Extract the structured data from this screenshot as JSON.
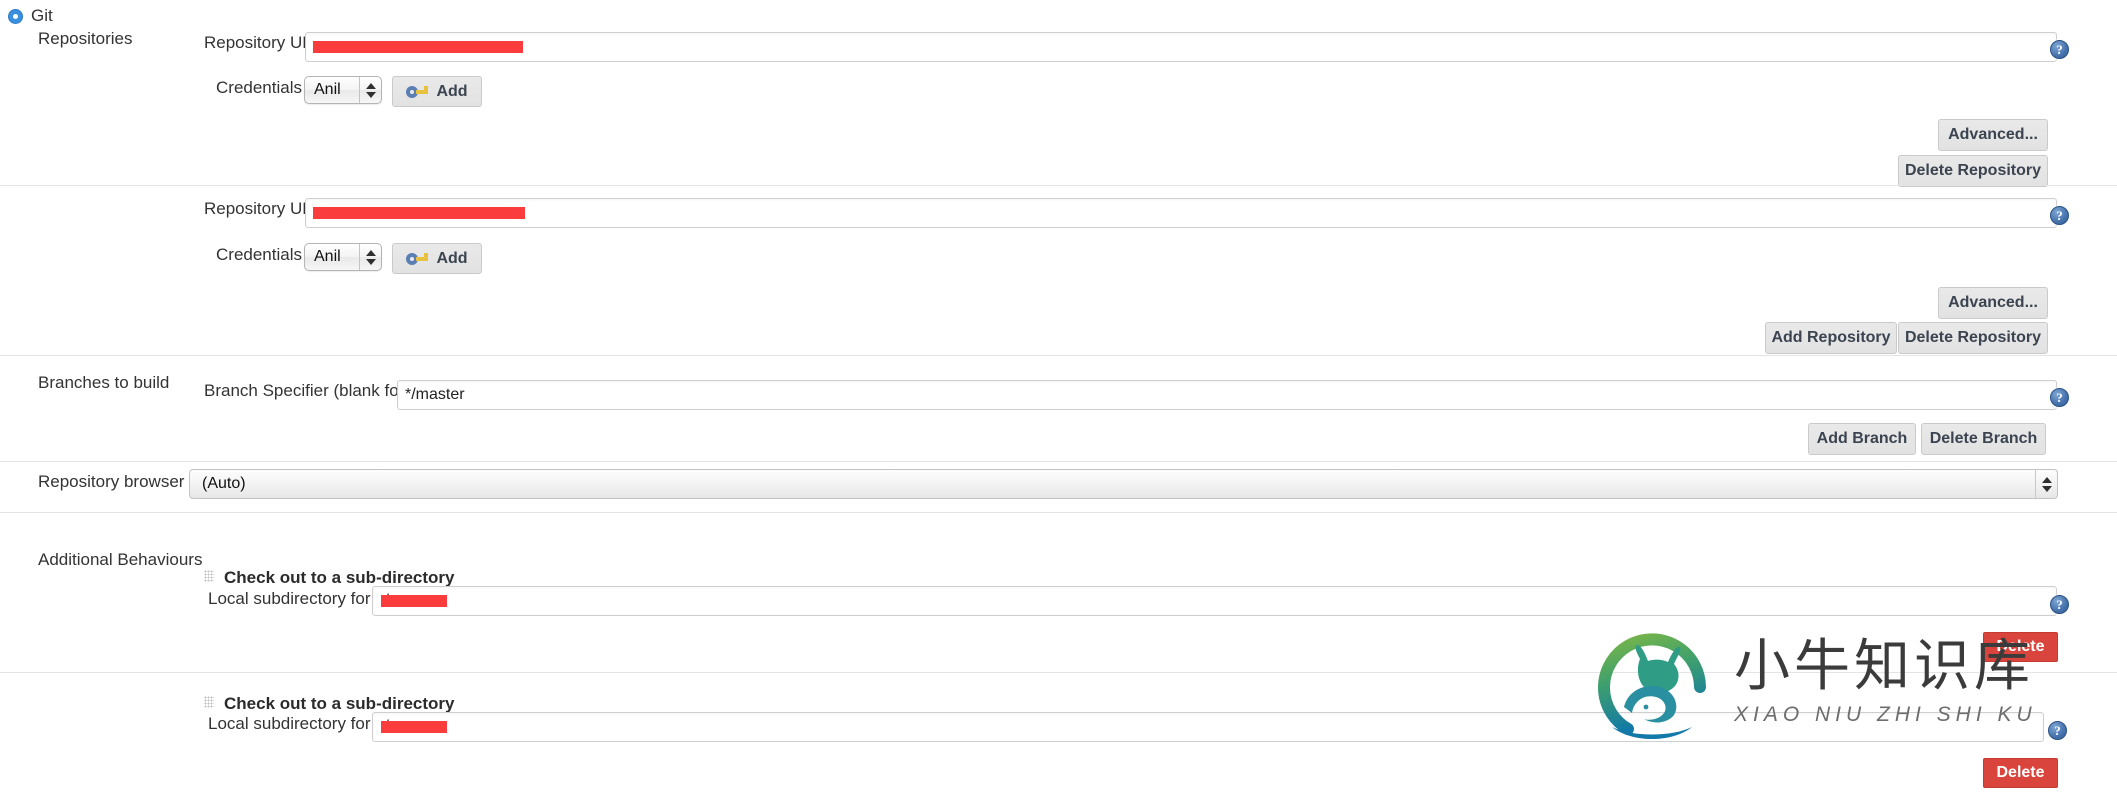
{
  "scm": {
    "selected_label": "Git",
    "radio_state": "selected"
  },
  "sections": {
    "repositories": "Repositories",
    "branches_to_build": "Branches to build",
    "repository_browser": "Repository browser",
    "additional_behaviours": "Additional Behaviours"
  },
  "repositories": [
    {
      "url_label": "Repository URL",
      "url_value": "",
      "url_redacted": true,
      "credentials_label": "Credentials",
      "credentials_value": "Anil",
      "add_credentials_label": "Add",
      "advanced_label": "Advanced...",
      "delete_label": "Delete Repository"
    },
    {
      "url_label": "Repository URL",
      "url_value": "",
      "url_redacted": true,
      "credentials_label": "Credentials",
      "credentials_value": "Anil",
      "add_credentials_label": "Add",
      "advanced_label": "Advanced...",
      "delete_label": "Delete Repository"
    }
  ],
  "repo_actions": {
    "add_repository_label": "Add Repository"
  },
  "branches": {
    "specifier_label": "Branch Specifier (blank for 'any')",
    "specifier_value": "*/master",
    "add_branch_label": "Add Branch",
    "delete_branch_label": "Delete Branch"
  },
  "browser": {
    "selected_value": "(Auto)"
  },
  "behaviours": [
    {
      "title": "Check out to a sub-directory",
      "field_label": "Local subdirectory for repo",
      "field_prefix": "./",
      "field_redacted": true,
      "delete_label": "Delete"
    },
    {
      "title": "Check out to a sub-directory",
      "field_label": "Local subdirectory for repo",
      "field_prefix": "./",
      "field_redacted": true,
      "delete_label": "Delete"
    }
  ],
  "help": {
    "glyph": "?"
  },
  "watermark": {
    "cn_text": "小牛知识库",
    "pinyin_text": "XIAO NIU ZHI SHI KU"
  },
  "colors": {
    "redaction": "#fa3c3c",
    "delete_button": "#d9443c",
    "radio_accent": "#3b8fe0",
    "help_icon": "#4a76b0",
    "watermark_green": "#4fa855",
    "watermark_blue": "#1b7fa8"
  }
}
